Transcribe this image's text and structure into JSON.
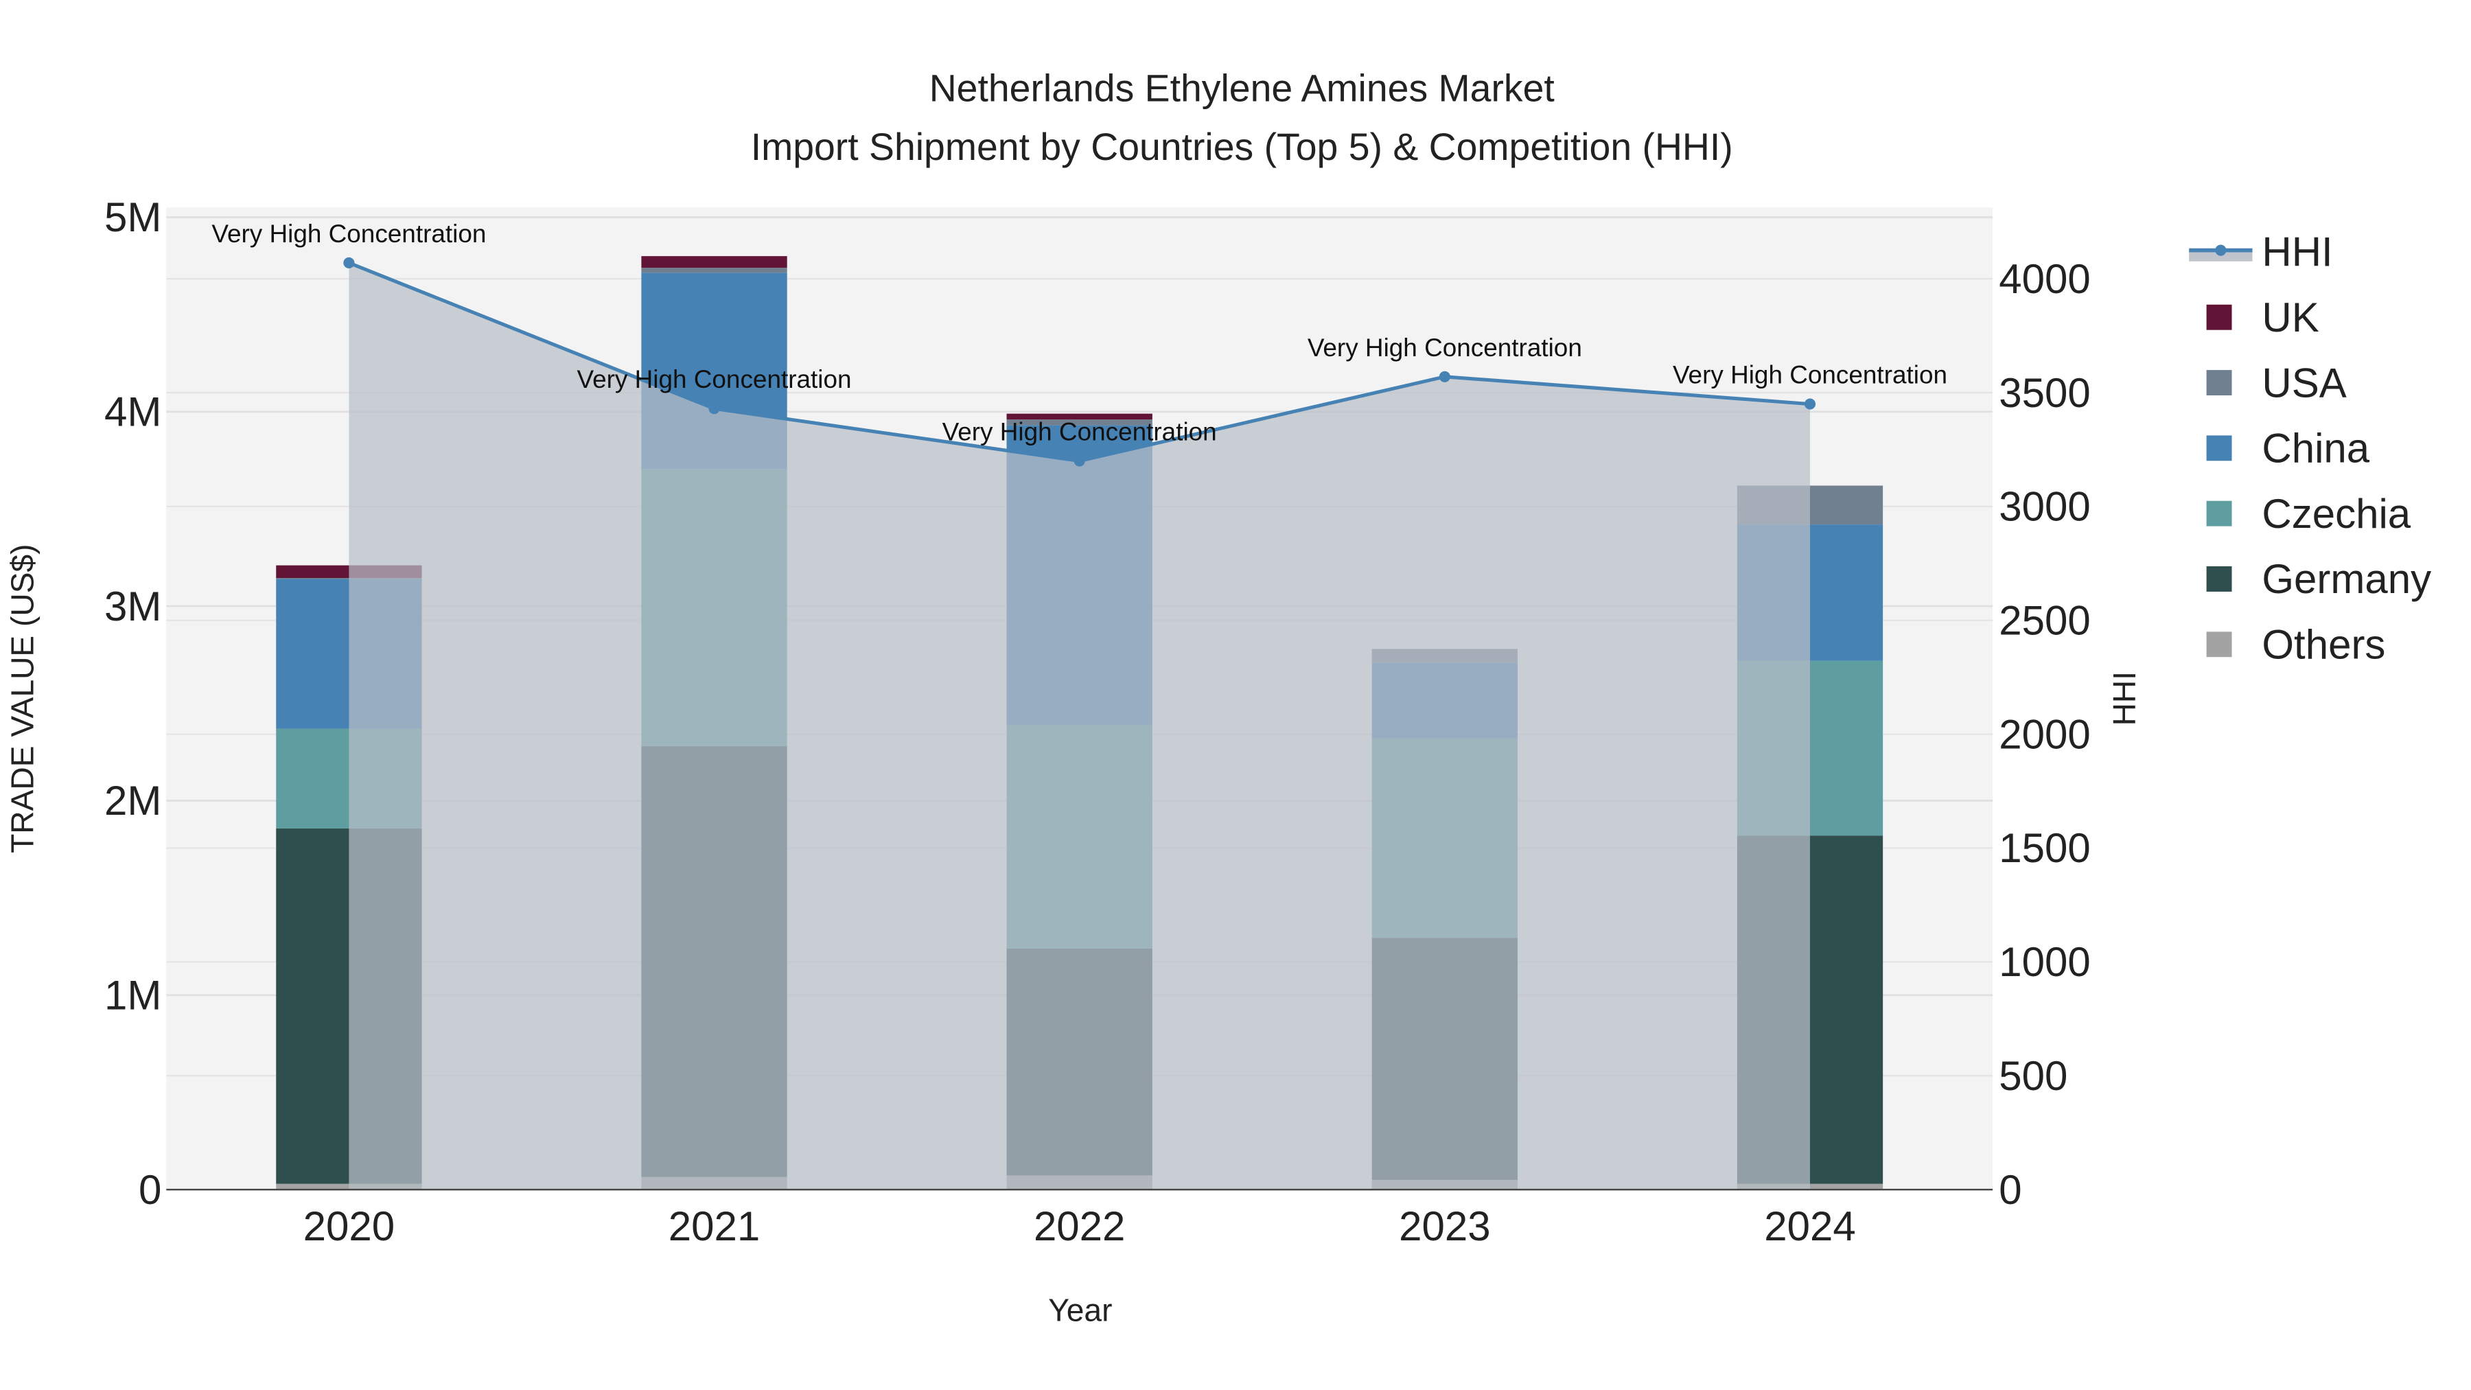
{
  "chart_data": {
    "type": "bar",
    "title": "Netherlands Ethylene Amines Market",
    "subtitle": "Import Shipment by Countries (Top 5) & Competition (HHI)",
    "xlabel": "Year",
    "ylabel": "TRADE VALUE (US$)",
    "y2label": "HHI",
    "categories": [
      "2020",
      "2021",
      "2022",
      "2023",
      "2024"
    ],
    "ylim": [
      0,
      5050000
    ],
    "y2lim": [
      0,
      4313
    ],
    "yticks": [
      0,
      1000000,
      2000000,
      3000000,
      4000000,
      5000000
    ],
    "ytick_labels": [
      "0",
      "1M",
      "2M",
      "3M",
      "4M",
      "5M"
    ],
    "y2ticks": [
      0,
      500,
      1000,
      1500,
      2000,
      2500,
      3000,
      3500,
      4000
    ],
    "y2tick_labels": [
      "0",
      "500",
      "1000",
      "1500",
      "2000",
      "2500",
      "3000",
      "3500",
      "4000"
    ],
    "series": [
      {
        "name": "Others",
        "color": "#a3a3a3",
        "values": [
          30000,
          65000,
          73000,
          50000,
          30000
        ]
      },
      {
        "name": "Germany",
        "color": "#2f4f4f",
        "values": [
          1827000,
          2215000,
          1167000,
          1245000,
          1790000
        ]
      },
      {
        "name": "Czechia",
        "color": "#5f9ea0",
        "values": [
          513000,
          1425000,
          1150000,
          1025000,
          900000
        ]
      },
      {
        "name": "China",
        "color": "#4682b4",
        "values": [
          770000,
          1010000,
          1540000,
          390000,
          700000
        ]
      },
      {
        "name": "USA",
        "color": "#708090",
        "values": [
          5000,
          25000,
          30000,
          70000,
          200000
        ]
      },
      {
        "name": "UK",
        "color": "#621436",
        "values": [
          65000,
          60000,
          30000,
          0,
          0
        ]
      }
    ],
    "hhi": {
      "name": "HHI",
      "color": "#4682b4",
      "values": [
        4070,
        3430,
        3200,
        3570,
        3450
      ],
      "annotations": [
        "Very High Concentration",
        "Very High Concentration",
        "Very High Concentration",
        "Very High Concentration",
        "Very High Concentration"
      ]
    },
    "legend": [
      "HHI",
      "UK",
      "USA",
      "China",
      "Czechia",
      "Germany",
      "Others"
    ],
    "legend_position": "right",
    "grid": true
  }
}
